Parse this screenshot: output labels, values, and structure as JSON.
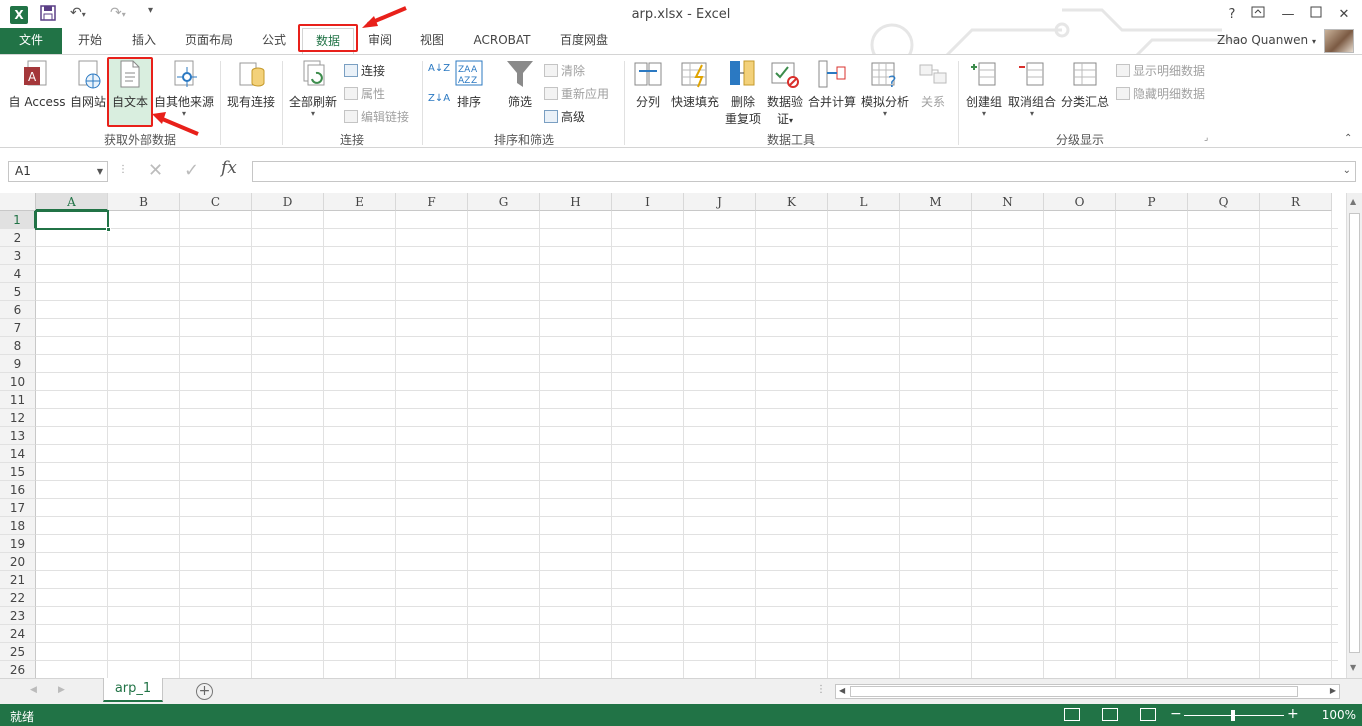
{
  "window": {
    "title": "arp.xlsx - Excel",
    "app_icon": "X",
    "help": "?",
    "user": "Zhao Quanwen"
  },
  "tabs": [
    {
      "label": "文件"
    },
    {
      "label": "开始"
    },
    {
      "label": "插入"
    },
    {
      "label": "页面布局"
    },
    {
      "label": "公式"
    },
    {
      "label": "数据"
    },
    {
      "label": "审阅"
    },
    {
      "label": "视图"
    },
    {
      "label": "ACROBAT"
    },
    {
      "label": "百度网盘"
    }
  ],
  "ribbon": {
    "groups": {
      "external": "获取外部数据",
      "connections": "连接",
      "sort_filter": "排序和筛选",
      "data_tools": "数据工具",
      "outline": "分级显示"
    },
    "external": {
      "access": "自 Access",
      "web": "自网站",
      "text": "自文本",
      "other": "自其他来源",
      "existing": "现有连接"
    },
    "connections": {
      "refresh_all": "全部刷新",
      "connections": "连接",
      "properties": "属性",
      "edit_links": "编辑链接"
    },
    "sort_filter": {
      "sort": "排序",
      "filter": "筛选",
      "clear": "清除",
      "reapply": "重新应用",
      "advanced": "高级",
      "az": "A↓Z",
      "za": "Z↓A"
    },
    "data_tools": {
      "text_to_columns": "分列",
      "flash_fill": "快速填充",
      "remove_dup_1": "删除",
      "remove_dup_2": "重复项",
      "validation_1": "数据验",
      "validation_2": "证",
      "consolidate": "合并计算",
      "what_if": "模拟分析",
      "relationships": "关系"
    },
    "outline": {
      "group": "创建组",
      "ungroup": "取消组合",
      "subtotal": "分类汇总",
      "show_detail": "显示明细数据",
      "hide_detail": "隐藏明细数据"
    }
  },
  "formula_bar": {
    "name_box": "A1",
    "cancel": "✕",
    "enter": "✓",
    "fx": "fx",
    "value": ""
  },
  "columns": [
    "A",
    "B",
    "C",
    "D",
    "E",
    "F",
    "G",
    "H",
    "I",
    "J",
    "K",
    "L",
    "M",
    "N",
    "O",
    "P",
    "Q",
    "R"
  ],
  "rows": [
    "1",
    "2",
    "3",
    "4",
    "5",
    "6",
    "7",
    "8",
    "9",
    "10",
    "11",
    "12",
    "13",
    "14",
    "15",
    "16",
    "17",
    "18",
    "19",
    "20",
    "21",
    "22",
    "23",
    "24",
    "25",
    "26"
  ],
  "selected_cell": "A1",
  "sheets": [
    {
      "label": "arp_1"
    }
  ],
  "add_sheet": "+",
  "status": {
    "ready": "就绪",
    "zoom_minus": "−",
    "zoom_plus": "+",
    "zoom": "100%"
  },
  "colors": {
    "excel_green": "#217346",
    "highlight_red": "#e8201a"
  }
}
